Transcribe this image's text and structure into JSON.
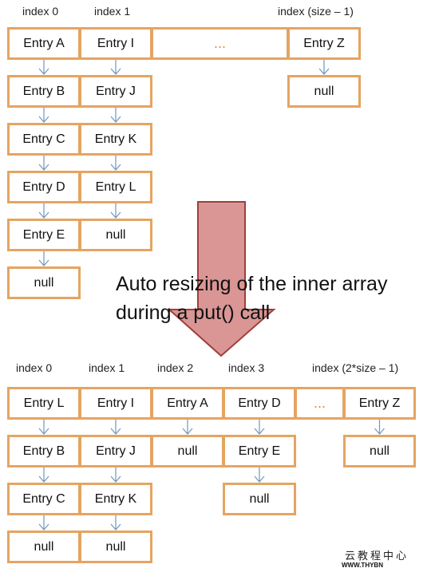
{
  "before": {
    "index_labels": [
      "index 0",
      "index 1",
      "index (size – 1)"
    ],
    "buckets": [
      [
        "Entry A",
        "Entry B",
        "Entry C",
        "Entry D",
        "Entry E",
        "null"
      ],
      [
        "Entry I",
        "Entry J",
        "Entry K",
        "Entry L",
        "null"
      ],
      [
        "..."
      ],
      [
        "Entry Z",
        "null"
      ]
    ]
  },
  "caption": [
    "Auto resizing of the inner array",
    "during a put() call"
  ],
  "after": {
    "index_labels": [
      "index 0",
      "index 1",
      "index 2",
      "index 3",
      "index (2*size – 1)"
    ],
    "buckets": [
      [
        "Entry L",
        "Entry B",
        "Entry C",
        "null"
      ],
      [
        "Entry I",
        "Entry J",
        "Entry K",
        "null"
      ],
      [
        "Entry A",
        "null"
      ],
      [
        "Entry D",
        "Entry E",
        "null"
      ],
      [
        "..."
      ],
      [
        "Entry Z",
        "null"
      ]
    ]
  },
  "watermark": [
    "云教程中心",
    "WWW.THYBN"
  ],
  "colors": {
    "box_border": "#e5a462",
    "link_arrow": "#6f97c0",
    "resize_arrow_fill": "#d99694",
    "resize_arrow_stroke": "#a0403c"
  }
}
